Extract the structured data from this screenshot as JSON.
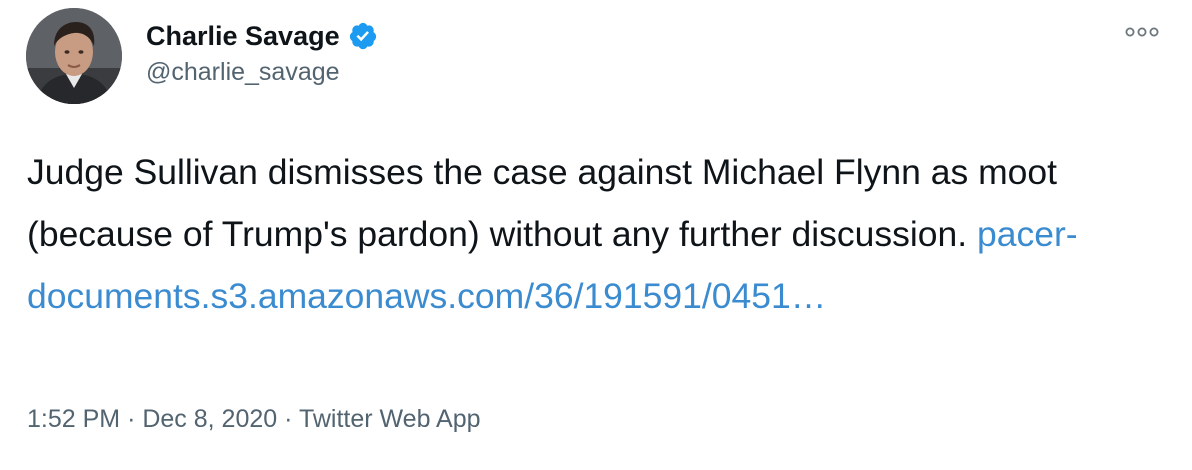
{
  "author": {
    "display_name": "Charlie Savage",
    "handle": "@charlie_savage",
    "verified": true,
    "avatar_icon": "profile-photo"
  },
  "menu": {
    "icon": "more-options-icon"
  },
  "tweet": {
    "text": "Judge Sullivan dismisses the case against Michael Flynn as moot (because of Trump's pardon) without any further discussion.",
    "link_line1": "pacer-",
    "link_line2": "documents.s3.amazonaws.com/36/191591/0451…"
  },
  "meta": {
    "time": "1:52 PM",
    "sep1": "·",
    "date": "Dec 8, 2020",
    "sep2": "·",
    "source": "Twitter Web App"
  },
  "colors": {
    "link": "#3b8bd0",
    "verified": "#1d9bf0",
    "secondary_text": "#536471"
  }
}
